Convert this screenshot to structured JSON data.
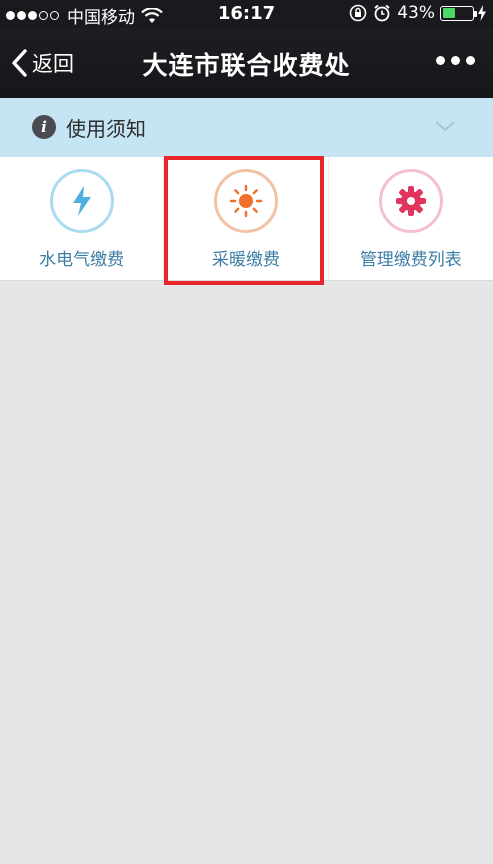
{
  "status_bar": {
    "carrier": "中国移动",
    "time": "16:17",
    "battery": "43%",
    "battery_level": 0.43
  },
  "nav": {
    "back_label": "返回",
    "title": "大连市联合收费处"
  },
  "notice": {
    "label": "使用须知"
  },
  "grid": {
    "items": [
      {
        "label": "水电气缴费",
        "icon": "lightning-icon",
        "color": "#58b6df",
        "ring": "#a9dcf1"
      },
      {
        "label": "采暖缴费",
        "icon": "sun-icon",
        "color": "#f06f2b",
        "ring": "#f3c1a6"
      },
      {
        "label": "管理缴费列表",
        "icon": "gear-icon",
        "color": "#e0365e",
        "ring": "#f4c0cb"
      }
    ]
  },
  "colors": {
    "highlight": "#e8262b",
    "notice_bg": "#c5e4f4",
    "label_text": "#3c7da6"
  }
}
